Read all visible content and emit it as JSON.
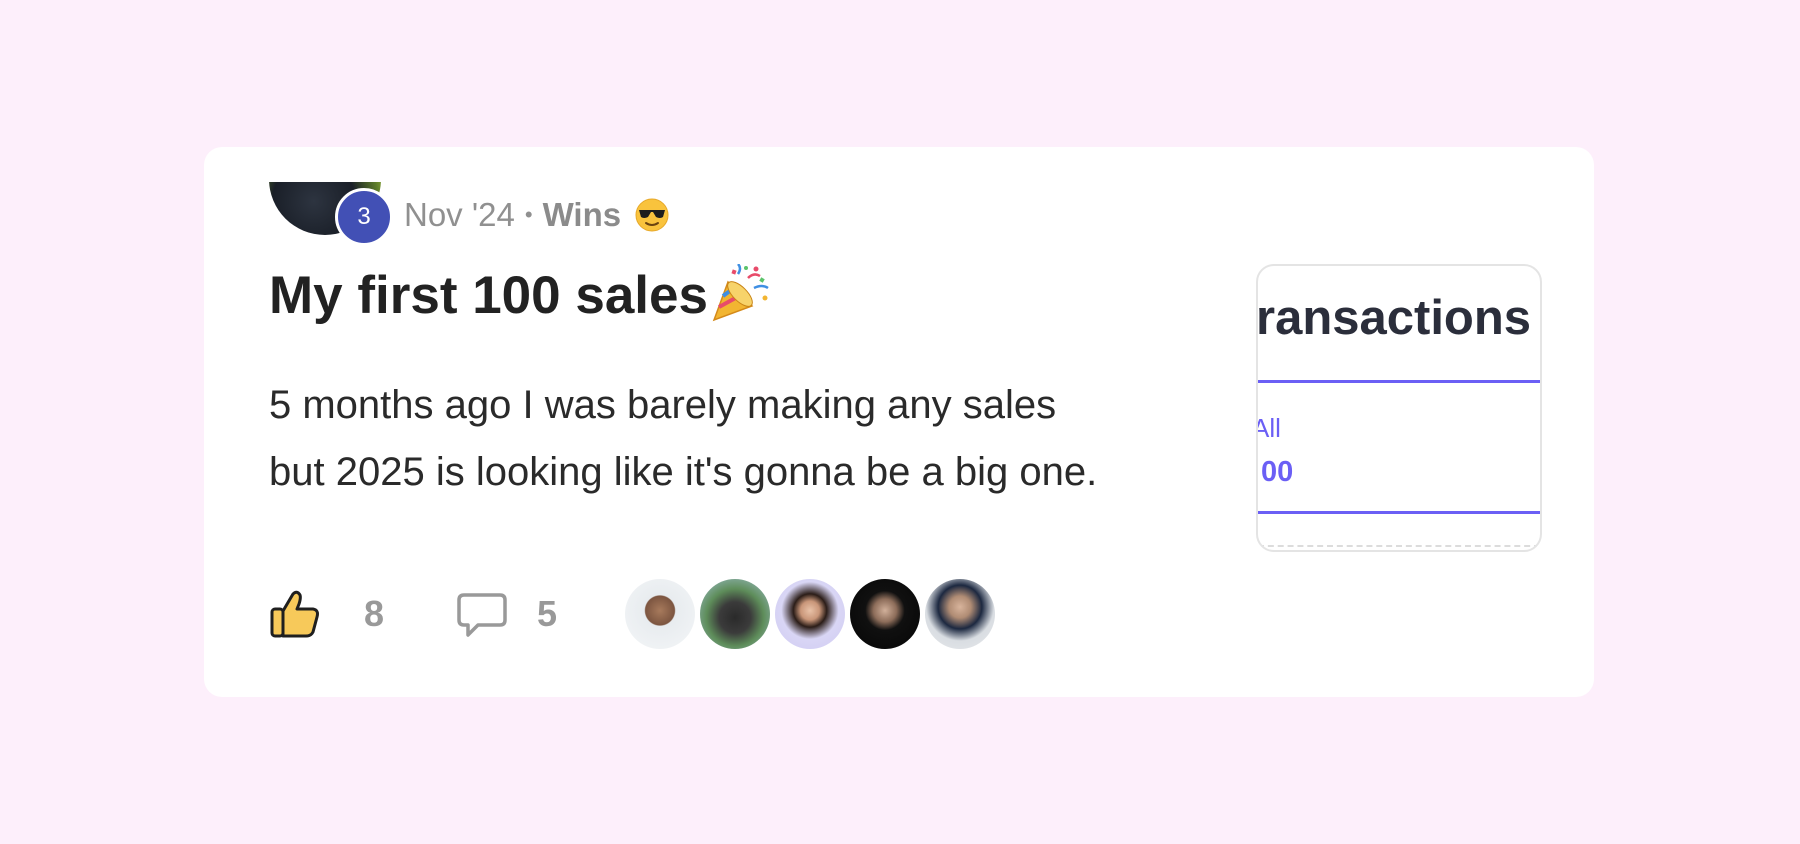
{
  "post": {
    "author_level": "3",
    "date": "Nov '24",
    "separator": "•",
    "category": "Wins",
    "category_emoji": "sunglasses-emoji",
    "title": "My first 100 sales",
    "title_emoji": "party-popper-emoji",
    "body_lines": [
      "5 months ago I was barely making any sales",
      "but 2025 is looking like it's gonna be a big one."
    ]
  },
  "attachment": {
    "title": "ransactions",
    "tab_label": "All",
    "value": "00"
  },
  "footer": {
    "like_icon": "thumbs-up-icon",
    "like_count": "8",
    "comment_icon": "comment-bubble-icon",
    "comment_count": "5",
    "member_avatars": 5
  },
  "colors": {
    "page_background": "#fdeffb",
    "card_background": "#ffffff",
    "level_badge": "#4250b5",
    "attachment_accent": "#6b5ff5",
    "like_icon_fill": "#f7c95a"
  }
}
